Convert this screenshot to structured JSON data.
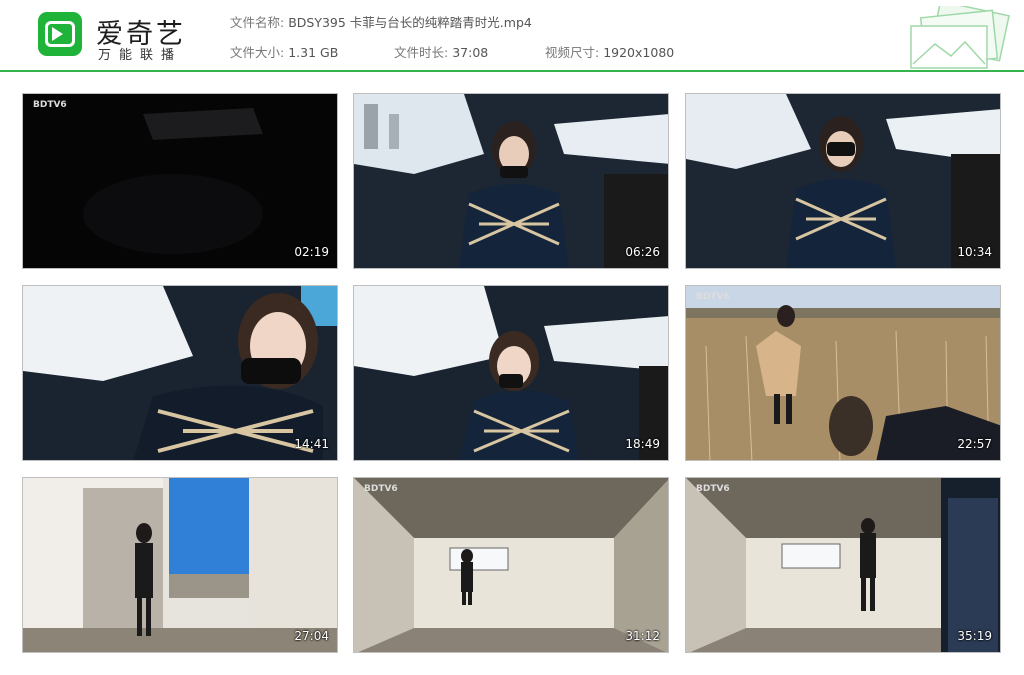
{
  "app": {
    "logo_text": "爱奇艺",
    "logo_sub": "万能联播",
    "accent_color": "#34b44a"
  },
  "file": {
    "name_label": "文件名称:",
    "name_value": "BDSY395 卡菲与台长的纯粹踏青时光.mp4",
    "size_label": "文件大小:",
    "size_value": "1.31 GB",
    "duration_label": "文件时长:",
    "duration_value": "37:08",
    "dims_label": "视频尺寸:",
    "dims_value": "1920x1080"
  },
  "thumbnails": [
    {
      "timestamp": "02:19",
      "scene": "dark-car",
      "tag": "BDTV6"
    },
    {
      "timestamp": "06:26",
      "scene": "car-front",
      "tag": ""
    },
    {
      "timestamp": "10:34",
      "scene": "car-front-2",
      "tag": ""
    },
    {
      "timestamp": "14:41",
      "scene": "car-closeup",
      "tag": ""
    },
    {
      "timestamp": "18:49",
      "scene": "car-side",
      "tag": ""
    },
    {
      "timestamp": "22:57",
      "scene": "field",
      "tag": "BDTV6"
    },
    {
      "timestamp": "27:04",
      "scene": "ruin-window",
      "tag": ""
    },
    {
      "timestamp": "31:12",
      "scene": "room",
      "tag": "BDTV6"
    },
    {
      "timestamp": "35:19",
      "scene": "room-2",
      "tag": "BDTV6"
    }
  ]
}
